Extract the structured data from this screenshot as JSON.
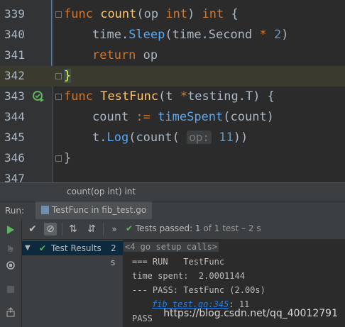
{
  "editor": {
    "lines": [
      {
        "num": "339"
      },
      {
        "num": "340"
      },
      {
        "num": "341"
      },
      {
        "num": "342"
      },
      {
        "num": "343"
      },
      {
        "num": "344"
      },
      {
        "num": "345"
      },
      {
        "num": "346"
      },
      {
        "num": "347"
      }
    ],
    "code": {
      "l339": {
        "kw1": "func",
        "name": "count",
        "open": "(op ",
        "t1": "int",
        "close": ") ",
        "t2": "int",
        "brace": " {"
      },
      "l340": {
        "pkg": "time.",
        "fn": "Sleep",
        "args1": "(time.Second ",
        "op": "*",
        "sp": " ",
        "num": "2",
        "end": ")"
      },
      "l341": {
        "kw": "return",
        "rest": " op"
      },
      "l342": {
        "brace": "}"
      },
      "l343": {
        "kw": "func",
        "name": "TestFunc",
        "rest": "(t ",
        "star": "*",
        "type": "testing.T",
        "end": ") {"
      },
      "l344": {
        "var": "count",
        "op": " := ",
        "fn": "timeSpent",
        "args": "(count)"
      },
      "l345": {
        "pre": "t.",
        "fn": "Log",
        "open": "(count( ",
        "hint": "op:",
        "num": "11",
        "end": "))"
      },
      "l346": {
        "brace": "}"
      }
    }
  },
  "tooltip": {
    "text": "count(op int) int"
  },
  "run_panel": {
    "label": "Run:",
    "tab": "TestFunc in fib_test.go",
    "status_check": "✔",
    "status_main": "Tests passed: ",
    "status_count": "1",
    "status_rest": " of 1 test – 2 s",
    "tree_item": "Test Results",
    "tree_time": "2 s",
    "console": {
      "setup": "<4 go setup calls>",
      "line1": "=== RUN   TestFunc",
      "line2": "time spent:  2.0001144",
      "line3": "--- PASS: TestFunc (2.00s)",
      "link": "fib_test.go:345",
      "line4_rest": ": 11",
      "line5": "PASS"
    }
  },
  "watermark": "https://blog.csdn.net/qq_40012791",
  "colors": {
    "keyword": "#cc7832",
    "function": "#ffc66d",
    "number": "#6897bb",
    "pass": "#5fb45f"
  }
}
